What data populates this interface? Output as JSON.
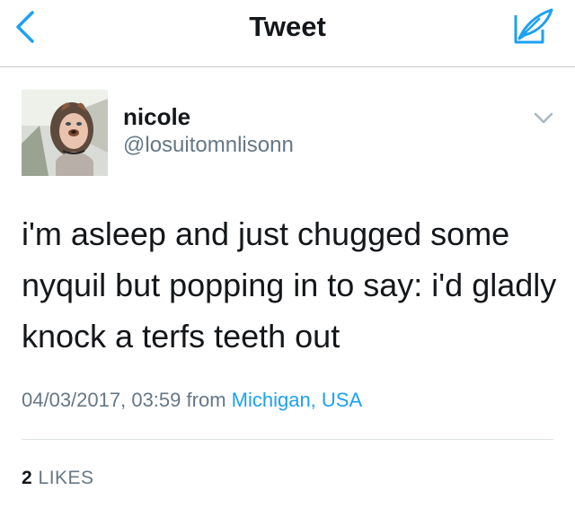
{
  "nav": {
    "title": "Tweet",
    "back_icon": "chevron-left-icon",
    "compose_icon": "compose-feather-icon",
    "accent": "#1da1f2"
  },
  "author": {
    "display_name": "nicole",
    "handle": "@losuitomnlisonn",
    "avatar": "profile-photo"
  },
  "tweet": {
    "text": "i'm asleep and just chugged some nyquil but popping in to say: i'd gladly knock a terfs teeth out",
    "timestamp": "04/03/2017, 03:59",
    "from_label": "from",
    "location": "Michigan, USA"
  },
  "stats": {
    "likes_count": "2",
    "likes_label": "LIKES"
  }
}
